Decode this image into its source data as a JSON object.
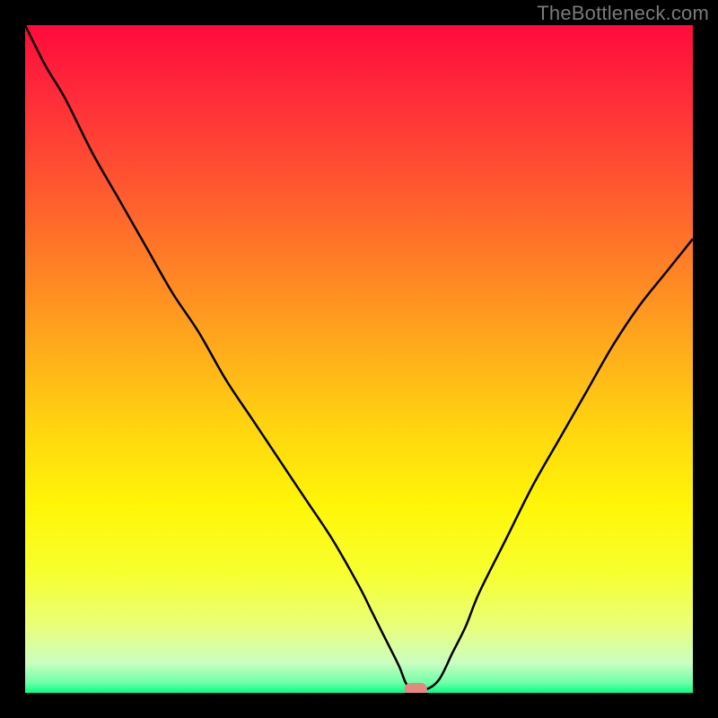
{
  "watermark": "TheBottleneck.com",
  "colors": {
    "black": "#000000",
    "salmon_marker": "#e5887f",
    "curve": "#000000",
    "gradient_stops": [
      {
        "offset": 0.0,
        "hex": "#ff0a3c"
      },
      {
        "offset": 0.1,
        "hex": "#ff2a3a"
      },
      {
        "offset": 0.22,
        "hex": "#ff5031"
      },
      {
        "offset": 0.35,
        "hex": "#ff7d26"
      },
      {
        "offset": 0.48,
        "hex": "#ffaa1c"
      },
      {
        "offset": 0.6,
        "hex": "#ffd40f"
      },
      {
        "offset": 0.72,
        "hex": "#fff608"
      },
      {
        "offset": 0.82,
        "hex": "#f7ff2e"
      },
      {
        "offset": 0.9,
        "hex": "#eaff7a"
      },
      {
        "offset": 0.955,
        "hex": "#caffc0"
      },
      {
        "offset": 0.985,
        "hex": "#6effa8"
      },
      {
        "offset": 1.0,
        "hex": "#00ff87"
      }
    ]
  },
  "chart_data": {
    "type": "line",
    "title": "",
    "xlabel": "",
    "ylabel": "",
    "xlim": [
      0,
      100
    ],
    "ylim": [
      0,
      100
    ],
    "grid": false,
    "legend": false,
    "curve": {
      "x": [
        0,
        3,
        6,
        10,
        14,
        18,
        22,
        26,
        30,
        34,
        38,
        42,
        46,
        50,
        52,
        54,
        56,
        57,
        58,
        60,
        62,
        64,
        66,
        68,
        72,
        76,
        80,
        84,
        88,
        92,
        96,
        100
      ],
      "y": [
        100,
        94,
        89,
        81,
        74,
        67,
        60,
        54,
        47,
        41,
        35,
        29,
        23,
        16,
        12,
        8,
        4,
        1.5,
        0.5,
        0.5,
        2,
        6,
        10,
        15,
        23,
        31,
        38,
        45,
        52,
        58,
        63,
        68
      ]
    },
    "marker": {
      "x": 58.5,
      "y": 0.5,
      "rx": 1.7,
      "ry": 1.0
    }
  }
}
